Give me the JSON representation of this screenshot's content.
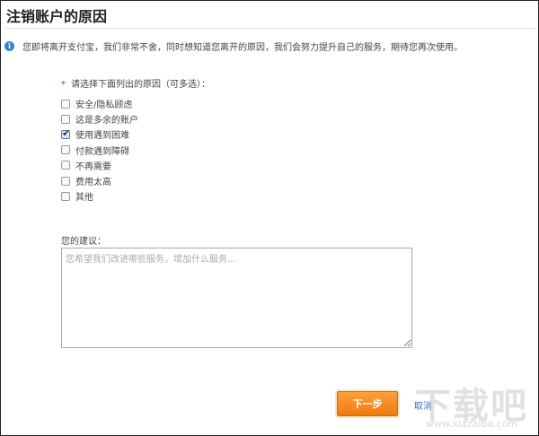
{
  "title": "注销账户的原因",
  "info": "您即将离开支付宝，我们非常不舍，同时想知道您离开的原因，我们会努力提升自己的服务，期待您再次使用。",
  "reasons_label": "请选择下面列出的原因（可多选）：",
  "required_mark": "*",
  "reasons": [
    {
      "label": "安全/隐私顾虑",
      "checked": false
    },
    {
      "label": "这是多余的账户",
      "checked": false
    },
    {
      "label": "使用遇到困难",
      "checked": true
    },
    {
      "label": "付款遇到障碍",
      "checked": false
    },
    {
      "label": "不再需要",
      "checked": false
    },
    {
      "label": "费用太高",
      "checked": false
    },
    {
      "label": "其他",
      "checked": false
    }
  ],
  "suggestion_label": "您的建议：",
  "suggestion_placeholder": "您希望我们改进哪些服务，增加什么服务...",
  "suggestion_value": "",
  "next_label": "下一步",
  "cancel_label": "取消",
  "watermark": "下载吧",
  "watermark_url": "www.xiazaiba.com"
}
